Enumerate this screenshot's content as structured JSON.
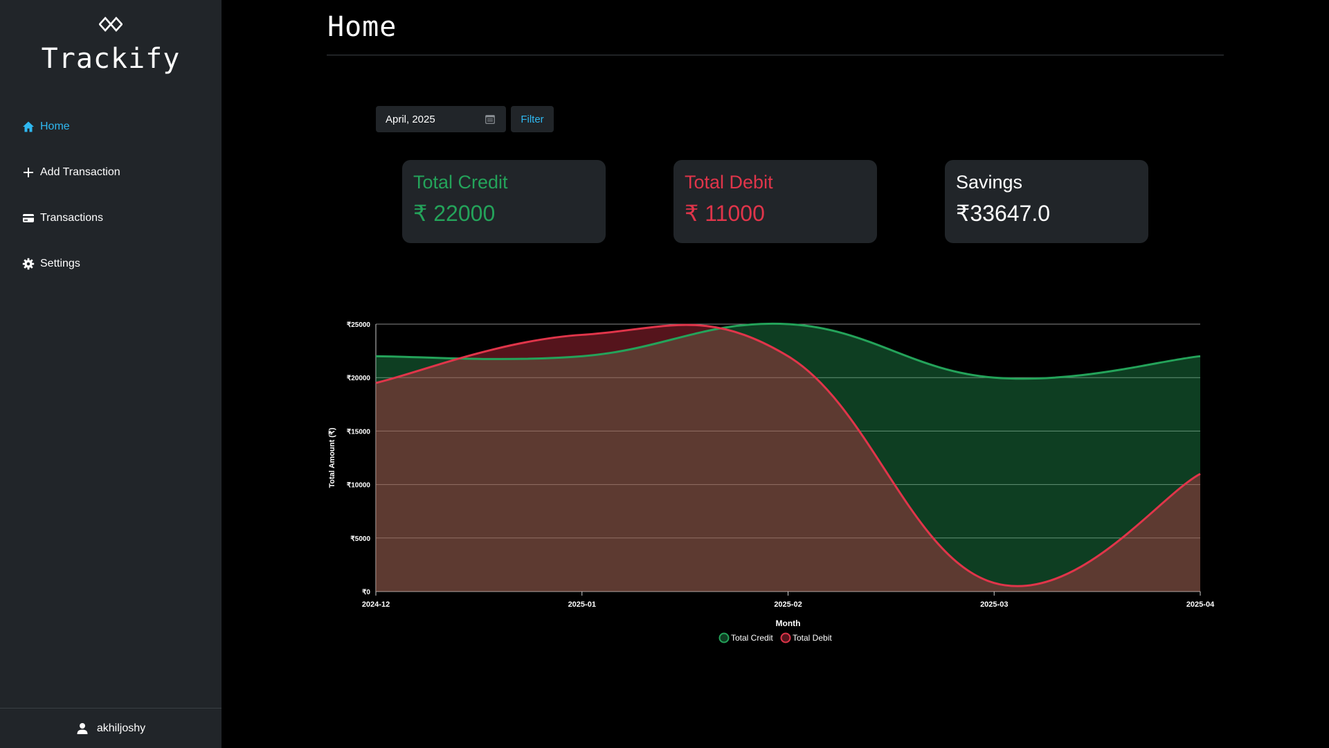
{
  "app": {
    "name": "Trackify"
  },
  "sidebar": {
    "items": [
      {
        "label": "Home",
        "icon": "home-icon",
        "active": true
      },
      {
        "label": "Add Transaction",
        "icon": "plus-icon",
        "active": false
      },
      {
        "label": "Transactions",
        "icon": "credit-card-icon",
        "active": false
      },
      {
        "label": "Settings",
        "icon": "gear-icon",
        "active": false
      }
    ],
    "user": {
      "name": "akhiljoshy",
      "icon": "user-icon"
    }
  },
  "page": {
    "title": "Home"
  },
  "filter": {
    "month_value": "April, 2025",
    "button_label": "Filter"
  },
  "cards": {
    "credit": {
      "title": "Total Credit",
      "value": "₹ 22000"
    },
    "debit": {
      "title": "Total Debit",
      "value": "₹ 11000"
    },
    "savings": {
      "title": "Savings",
      "value": "₹33647.0"
    }
  },
  "colors": {
    "accent": "#2fb8f0",
    "credit": "#24a35a",
    "debit": "#e0354a",
    "sidebar_bg": "#212529",
    "background": "#000000"
  },
  "chart_data": {
    "type": "area",
    "categories": [
      "2024-12",
      "2025-01",
      "2025-02",
      "2025-03",
      "2025-04"
    ],
    "series": [
      {
        "name": "Total Credit",
        "values": [
          22000,
          22000,
          25000,
          20000,
          22000
        ],
        "color": "#24a35a"
      },
      {
        "name": "Total Debit",
        "values": [
          19500,
          24000,
          22000,
          800,
          11000
        ],
        "color": "#e0354a"
      }
    ],
    "xlabel": "Month",
    "ylabel": "Total Amount (₹)",
    "ylim": [
      0,
      25000
    ],
    "yticks": [
      0,
      5000,
      10000,
      15000,
      20000,
      25000
    ],
    "ytick_prefix": "₹",
    "grid": true,
    "legend": "bottom-center"
  }
}
